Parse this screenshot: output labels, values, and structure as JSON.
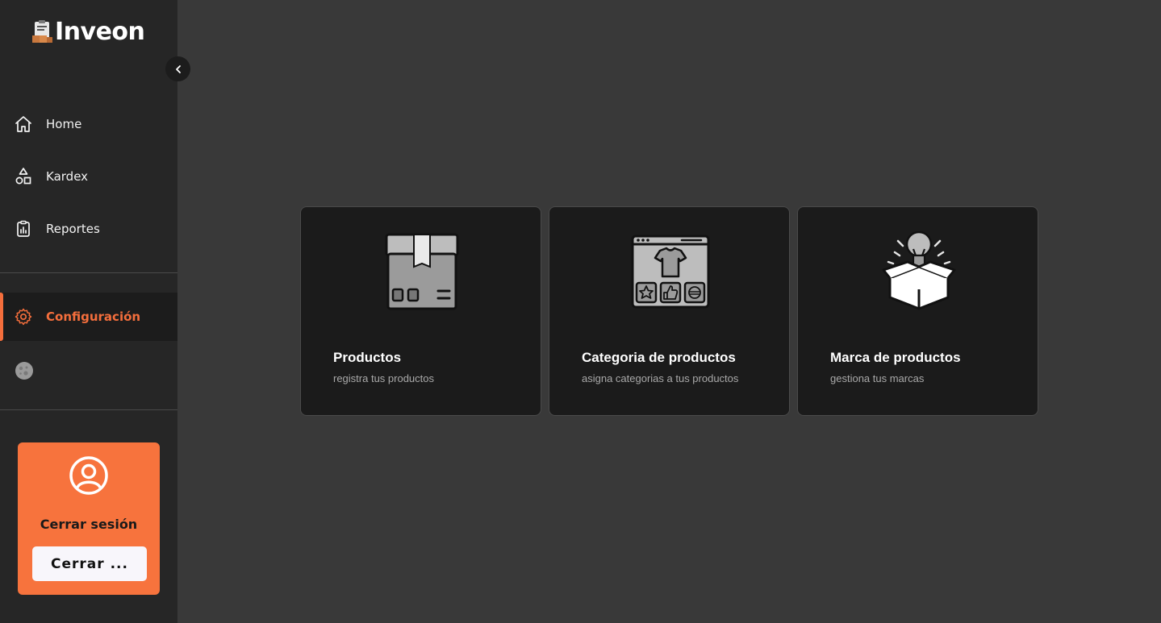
{
  "app": {
    "name": "Inveon"
  },
  "sidebar": {
    "items": [
      {
        "label": "Home",
        "icon": "home-icon"
      },
      {
        "label": "Kardex",
        "icon": "shapes-icon"
      },
      {
        "label": "Reportes",
        "icon": "clipboard-report-icon"
      }
    ],
    "config": {
      "label": "Configuración",
      "icon": "gear-icon",
      "active": true
    },
    "theme_icon": "moon-icon"
  },
  "logout": {
    "title": "Cerrar sesión",
    "button_label": "Cerrar ...",
    "icon": "user-circle-icon"
  },
  "cards": [
    {
      "title": "Productos",
      "subtitle": "registra tus productos",
      "icon": "box-icon"
    },
    {
      "title": "Categoria de productos",
      "subtitle": "asigna categorias a tus productos",
      "icon": "store-shirt-icon"
    },
    {
      "title": "Marca de productos",
      "subtitle": "gestiona tus marcas",
      "icon": "box-lightbulb-icon"
    }
  ],
  "colors": {
    "accent": "#f46e3c",
    "sidebar_bg": "#262626",
    "main_bg": "#393939",
    "card_bg": "#1b1b1b"
  }
}
